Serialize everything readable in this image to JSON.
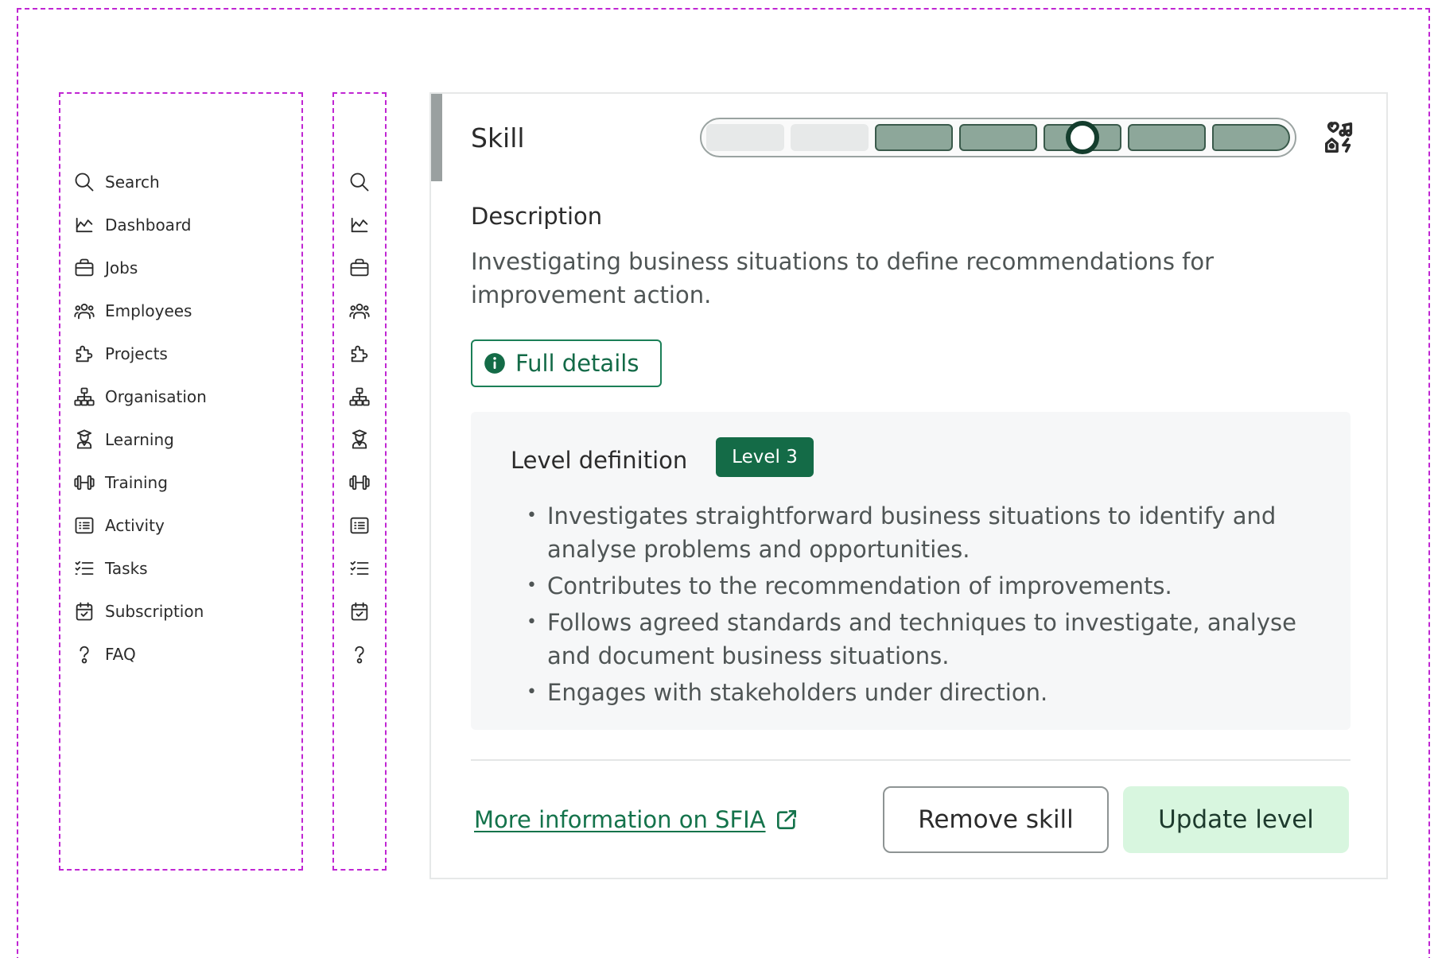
{
  "nav": [
    {
      "label": "Search",
      "icon": "search-icon"
    },
    {
      "label": "Dashboard",
      "icon": "chart-line-icon"
    },
    {
      "label": "Jobs",
      "icon": "briefcase-icon"
    },
    {
      "label": "Employees",
      "icon": "users-icon"
    },
    {
      "label": "Projects",
      "icon": "puzzle-icon"
    },
    {
      "label": "Organisation",
      "icon": "org-chart-icon"
    },
    {
      "label": "Learning",
      "icon": "graduate-icon"
    },
    {
      "label": "Training",
      "icon": "dumbbell-icon"
    },
    {
      "label": "Activity",
      "icon": "list-details-icon"
    },
    {
      "label": "Tasks",
      "icon": "checklist-icon"
    },
    {
      "label": "Subscription",
      "icon": "calendar-check-icon"
    },
    {
      "label": "FAQ",
      "icon": "help-icon"
    }
  ],
  "skill": {
    "title": "Skill",
    "level_scale": {
      "total_segments": 7,
      "filled_from": 3,
      "current_level": 3
    },
    "icon": "skills-icon",
    "description_heading": "Description",
    "description_text": "Investigating business situations to define recommendations for improvement action.",
    "full_details_label": "Full details",
    "level_definition": {
      "title": "Level definition",
      "badge": "Level 3",
      "bullets": [
        "Investigates straightforward business situations to identify and analyse problems and opportunities.",
        "Contributes to the recommendation of improvements.",
        "Follows agreed standards and techniques to investigate, analyse and document business situations.",
        "Engages with stakeholders under direction."
      ]
    },
    "more_info_label": "More information on SFIA",
    "remove_label": "Remove skill",
    "update_label": "Update level"
  },
  "colors": {
    "accent": "#146b47",
    "accent_light": "#d8f6df",
    "frame": "#c026d3",
    "segment_filled": "#8da79a",
    "segment_empty": "#e7e9e9"
  }
}
